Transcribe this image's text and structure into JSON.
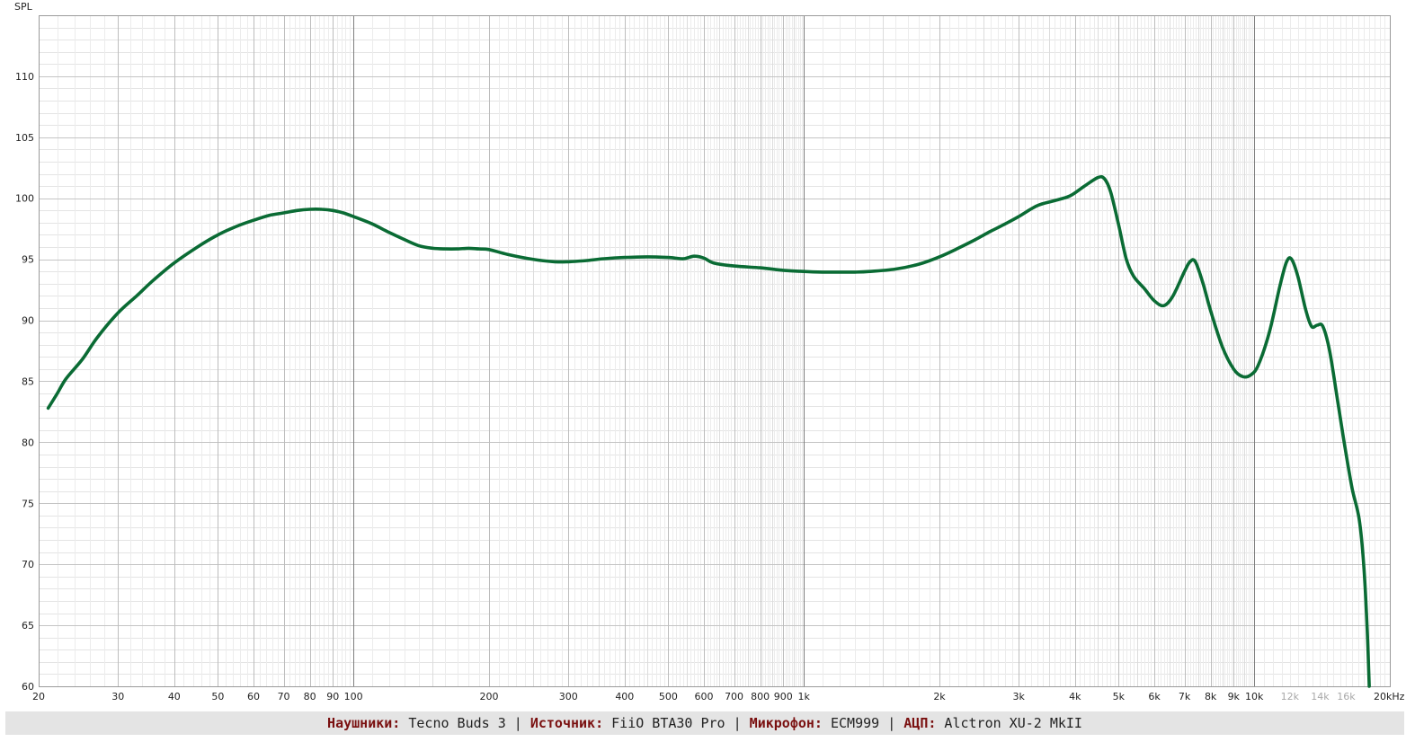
{
  "chart_data": {
    "type": "line",
    "title": "",
    "xlabel": "",
    "ylabel": "SPL",
    "x_scale": "log",
    "xlim": [
      20,
      20000
    ],
    "ylim": [
      60,
      115
    ],
    "grid": true,
    "x_tick_labels": [
      {
        "f": 20,
        "label": "20",
        "faint": false
      },
      {
        "f": 30,
        "label": "30",
        "faint": false
      },
      {
        "f": 40,
        "label": "40",
        "faint": false
      },
      {
        "f": 50,
        "label": "50",
        "faint": false
      },
      {
        "f": 60,
        "label": "60",
        "faint": false
      },
      {
        "f": 70,
        "label": "70",
        "faint": false
      },
      {
        "f": 80,
        "label": "80",
        "faint": false
      },
      {
        "f": 90,
        "label": "90",
        "faint": false
      },
      {
        "f": 100,
        "label": "100",
        "faint": false
      },
      {
        "f": 200,
        "label": "200",
        "faint": false
      },
      {
        "f": 300,
        "label": "300",
        "faint": false
      },
      {
        "f": 400,
        "label": "400",
        "faint": false
      },
      {
        "f": 500,
        "label": "500",
        "faint": false
      },
      {
        "f": 600,
        "label": "600",
        "faint": false
      },
      {
        "f": 700,
        "label": "700",
        "faint": false
      },
      {
        "f": 800,
        "label": "800",
        "faint": false
      },
      {
        "f": 900,
        "label": "900",
        "faint": false
      },
      {
        "f": 1000,
        "label": "1k",
        "faint": false
      },
      {
        "f": 2000,
        "label": "2k",
        "faint": false
      },
      {
        "f": 3000,
        "label": "3k",
        "faint": false
      },
      {
        "f": 4000,
        "label": "4k",
        "faint": false
      },
      {
        "f": 5000,
        "label": "5k",
        "faint": false
      },
      {
        "f": 6000,
        "label": "6k",
        "faint": false
      },
      {
        "f": 7000,
        "label": "7k",
        "faint": false
      },
      {
        "f": 8000,
        "label": "8k",
        "faint": false
      },
      {
        "f": 9000,
        "label": "9k",
        "faint": false
      },
      {
        "f": 10000,
        "label": "10k",
        "faint": false
      },
      {
        "f": 12000,
        "label": "12k",
        "faint": true
      },
      {
        "f": 14000,
        "label": "14k",
        "faint": true
      },
      {
        "f": 16000,
        "label": "16k",
        "faint": true
      },
      {
        "f": 20000,
        "label": "20kHz",
        "faint": false
      }
    ],
    "y_ticks": [
      60,
      65,
      70,
      75,
      80,
      85,
      90,
      95,
      100,
      105,
      110
    ],
    "series": [
      {
        "name": "",
        "color": "#0a6b34",
        "points": [
          [
            21,
            82.8
          ],
          [
            22,
            84.0
          ],
          [
            23,
            85.2
          ],
          [
            25,
            86.8
          ],
          [
            27,
            88.6
          ],
          [
            30,
            90.6
          ],
          [
            33,
            92.0
          ],
          [
            36,
            93.3
          ],
          [
            40,
            94.7
          ],
          [
            45,
            96.0
          ],
          [
            50,
            97.0
          ],
          [
            55,
            97.7
          ],
          [
            60,
            98.2
          ],
          [
            65,
            98.6
          ],
          [
            70,
            98.8
          ],
          [
            75,
            99.0
          ],
          [
            80,
            99.1
          ],
          [
            85,
            99.1
          ],
          [
            90,
            99.0
          ],
          [
            95,
            98.8
          ],
          [
            100,
            98.5
          ],
          [
            110,
            97.9
          ],
          [
            120,
            97.2
          ],
          [
            130,
            96.6
          ],
          [
            140,
            96.1
          ],
          [
            150,
            95.9
          ],
          [
            160,
            95.85
          ],
          [
            170,
            95.85
          ],
          [
            180,
            95.9
          ],
          [
            190,
            95.85
          ],
          [
            200,
            95.8
          ],
          [
            220,
            95.4
          ],
          [
            250,
            95.0
          ],
          [
            280,
            94.8
          ],
          [
            300,
            94.8
          ],
          [
            330,
            94.9
          ],
          [
            360,
            95.05
          ],
          [
            400,
            95.15
          ],
          [
            450,
            95.2
          ],
          [
            500,
            95.15
          ],
          [
            540,
            95.05
          ],
          [
            570,
            95.25
          ],
          [
            600,
            95.1
          ],
          [
            630,
            94.7
          ],
          [
            700,
            94.45
          ],
          [
            800,
            94.3
          ],
          [
            900,
            94.1
          ],
          [
            1000,
            94.0
          ],
          [
            1100,
            93.95
          ],
          [
            1200,
            93.95
          ],
          [
            1300,
            93.95
          ],
          [
            1400,
            94.0
          ],
          [
            1600,
            94.2
          ],
          [
            1800,
            94.6
          ],
          [
            2000,
            95.2
          ],
          [
            2200,
            95.9
          ],
          [
            2400,
            96.6
          ],
          [
            2600,
            97.3
          ],
          [
            2800,
            97.9
          ],
          [
            3000,
            98.5
          ],
          [
            3300,
            99.4
          ],
          [
            3600,
            99.8
          ],
          [
            3900,
            100.2
          ],
          [
            4200,
            101.0
          ],
          [
            4500,
            101.7
          ],
          [
            4650,
            101.6
          ],
          [
            4800,
            100.5
          ],
          [
            5000,
            97.8
          ],
          [
            5200,
            95.0
          ],
          [
            5400,
            93.6
          ],
          [
            5700,
            92.6
          ],
          [
            6000,
            91.6
          ],
          [
            6300,
            91.2
          ],
          [
            6600,
            92.0
          ],
          [
            7000,
            94.0
          ],
          [
            7200,
            94.8
          ],
          [
            7400,
            94.8
          ],
          [
            7700,
            93.0
          ],
          [
            8000,
            90.8
          ],
          [
            8500,
            87.8
          ],
          [
            9000,
            86.0
          ],
          [
            9400,
            85.4
          ],
          [
            9800,
            85.5
          ],
          [
            10200,
            86.3
          ],
          [
            10800,
            89.0
          ],
          [
            11400,
            92.8
          ],
          [
            11800,
            94.8
          ],
          [
            12100,
            95.0
          ],
          [
            12500,
            93.6
          ],
          [
            13000,
            90.9
          ],
          [
            13400,
            89.5
          ],
          [
            13800,
            89.6
          ],
          [
            14200,
            89.5
          ],
          [
            14700,
            87.5
          ],
          [
            15300,
            83.5
          ],
          [
            15900,
            79.6
          ],
          [
            16500,
            76.2
          ],
          [
            17100,
            73.7
          ],
          [
            17500,
            70.0
          ],
          [
            17800,
            65.0
          ],
          [
            18000,
            60.0
          ]
        ]
      }
    ]
  },
  "footer": {
    "label_headphones": "Наушники:",
    "value_headphones": "Tecno Buds 3",
    "label_source": "Источник:",
    "value_source": "FiiO BTA30 Pro",
    "label_mic": "Микрофон:",
    "value_mic": "ECM999",
    "label_adc": "АЦП:",
    "value_adc": "Alctron XU-2 MkII",
    "separator": "|"
  }
}
